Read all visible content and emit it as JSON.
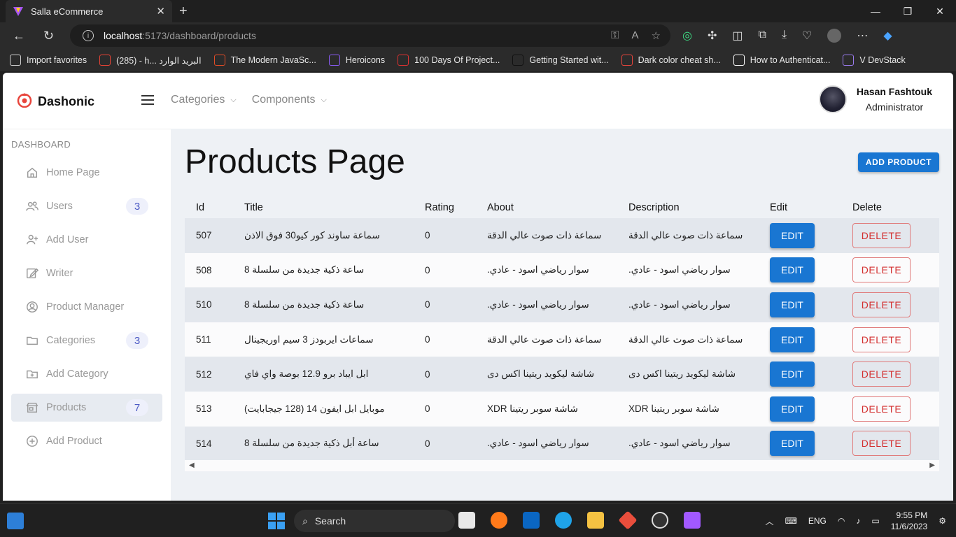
{
  "browser": {
    "tab_title": "Salla eCommerce",
    "url_host": "localhost",
    "url_path": ":5173/dashboard/products",
    "bookmarks": [
      {
        "label": "Import favorites",
        "icon": "import-icon",
        "color": "#cfcfcf"
      },
      {
        "label": "(285) - h... البريد الوارد",
        "icon": "gmail-icon",
        "color": "#ea4335"
      },
      {
        "label": "The Modern JavaSc...",
        "icon": "js-icon",
        "color": "#e34c26"
      },
      {
        "label": "Heroicons",
        "icon": "heroicons-icon",
        "color": "#8b5cf6"
      },
      {
        "label": "100 Days Of Project...",
        "icon": "c-icon",
        "color": "#e03131"
      },
      {
        "label": "Getting Started wit...",
        "icon": "next-icon",
        "color": "#111111"
      },
      {
        "label": "Dark color cheat sh...",
        "icon": "sw-icon",
        "color": "#e8453c"
      },
      {
        "label": "How to Authenticat...",
        "icon": "medium-icon",
        "color": "#ffffff"
      },
      {
        "label": "V DevStack",
        "icon": "code-icon",
        "color": "#9b7cf0"
      }
    ]
  },
  "app": {
    "brand": "Dashonic",
    "nav": [
      {
        "label": "Categories"
      },
      {
        "label": "Components"
      }
    ],
    "user": {
      "name": "Hasan Fashtouk",
      "role": "Administrator"
    }
  },
  "sidebar": {
    "heading": "DASHBOARD",
    "items": [
      {
        "label": "Home Page",
        "icon": "home-icon",
        "badge": ""
      },
      {
        "label": "Users",
        "icon": "users-icon",
        "badge": "3"
      },
      {
        "label": "Add User",
        "icon": "add-user-icon",
        "badge": ""
      },
      {
        "label": "Writer",
        "icon": "edit-icon",
        "badge": ""
      },
      {
        "label": "Product Manager",
        "icon": "user-circle-icon",
        "badge": ""
      },
      {
        "label": "Categories",
        "icon": "folder-icon",
        "badge": "3"
      },
      {
        "label": "Add Category",
        "icon": "folder-add-icon",
        "badge": ""
      },
      {
        "label": "Products",
        "icon": "store-icon",
        "badge": "7",
        "active": true
      },
      {
        "label": "Add Product",
        "icon": "plus-circle-icon",
        "badge": ""
      }
    ]
  },
  "main": {
    "title": "Products Page",
    "add_button": "ADD PRODUCT",
    "columns": [
      "Id",
      "Title",
      "Rating",
      "About",
      "Description",
      "Edit",
      "Delete"
    ],
    "edit_label": "EDIT",
    "delete_label": "DELETE",
    "rows": [
      {
        "id": "507",
        "title": "سماعة ساوند كور كيو30 فوق الاذن",
        "rating": "0",
        "about": "سماعة ذات صوت عالي الدقة",
        "description": "سماعة ذات صوت عالي الدقة"
      },
      {
        "id": "508",
        "title": "ساعة ذكية جديدة من سلسلة 8",
        "rating": "0",
        "about": "سوار رياضي اسود - عادي.",
        "description": "سوار رياضي اسود - عادي."
      },
      {
        "id": "510",
        "title": "ساعة ذكية جديدة من سلسلة 8",
        "rating": "0",
        "about": "سوار رياضي اسود - عادي.",
        "description": "سوار رياضي اسود - عادي."
      },
      {
        "id": "511",
        "title": "سماعات ايربودز 3 سيم اوريجينال",
        "rating": "0",
        "about": "سماعة ذات صوت عالي الدقة",
        "description": "سماعة ذات صوت عالي الدقة"
      },
      {
        "id": "512",
        "title": "ابل ايباد برو 12.9 بوصة واي فاي",
        "rating": "0",
        "about": "شاشة ليكويد ريتينا اكس دى",
        "description": "شاشة ليكويد ريتينا اكس دى"
      },
      {
        "id": "513",
        "title": "موبايل ابل ايفون 14 (128 جيجابايت)",
        "rating": "0",
        "about": "شاشة سوبر ريتينا XDR",
        "description": "شاشة سوبر ريتينا XDR"
      },
      {
        "id": "514",
        "title": "ساعة أبل ذكية جديدة من سلسلة 8",
        "rating": "0",
        "about": "سوار رياضي اسود - عادي.",
        "description": "سوار رياضي اسود - عادي."
      }
    ]
  },
  "taskbar": {
    "search_label": "Search",
    "language": "ENG",
    "time": "9:55 PM",
    "date": "11/6/2023"
  },
  "colors": {
    "primary": "#1976d2",
    "danger": "#d32f2f",
    "badge_text": "#4b59c4"
  }
}
